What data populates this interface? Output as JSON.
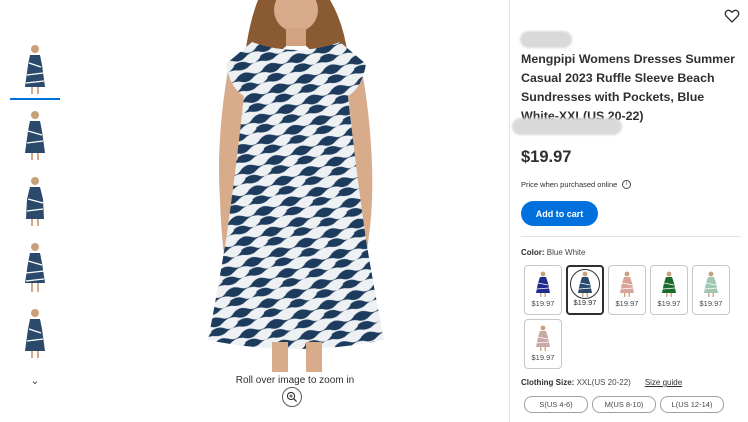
{
  "thumbnails": [
    {
      "alt": "dress-thumbnail-1",
      "selected": true
    },
    {
      "alt": "dress-thumbnail-2",
      "selected": false
    },
    {
      "alt": "dress-thumbnail-3",
      "selected": false
    },
    {
      "alt": "dress-thumbnail-4",
      "selected": false
    },
    {
      "alt": "dress-thumbnail-5",
      "selected": false
    }
  ],
  "thumbs_more_icon": "chevron-down-icon",
  "viewer": {
    "zoom_hint": "Roll over image to zoom in",
    "zoom_icon": "zoom-in-icon"
  },
  "product": {
    "title": "Mengpipi Womens Dresses Summer Casual 2023 Ruffle Sleeve Beach Sundresses with Pockets, Blue White-XXL(US 20-22)",
    "price": "$19.97",
    "price_note": "Price when purchased online",
    "add_to_cart": "Add to cart"
  },
  "color": {
    "label": "Color:",
    "value": "Blue White",
    "swatches": [
      {
        "name": "Navy Floral",
        "price": "$19.97",
        "selected": false,
        "color": "#1f2a8a"
      },
      {
        "name": "Blue White",
        "price": "$19.97",
        "selected": true,
        "color": "#2b4a6b"
      },
      {
        "name": "Pink Floral",
        "price": "$19.97",
        "selected": false,
        "color": "#d7a49a"
      },
      {
        "name": "Green",
        "price": "$19.97",
        "selected": false,
        "color": "#1e6b2e"
      },
      {
        "name": "Mint Floral",
        "price": "$19.97",
        "selected": false,
        "color": "#9fc7b2"
      },
      {
        "name": "White Floral",
        "price": "$19.97",
        "selected": false,
        "color": "#c9a9a6"
      }
    ]
  },
  "size": {
    "label": "Clothing Size:",
    "value": "XXL(US 20-22)",
    "guide": "Size guide",
    "options": [
      "S(US 4-6)",
      "M(US 8-10)",
      "L(US 12-14)"
    ]
  },
  "colors": {
    "accent": "#0071dc",
    "text": "#2e2f32",
    "dress_blue": "#1d3b5c"
  }
}
